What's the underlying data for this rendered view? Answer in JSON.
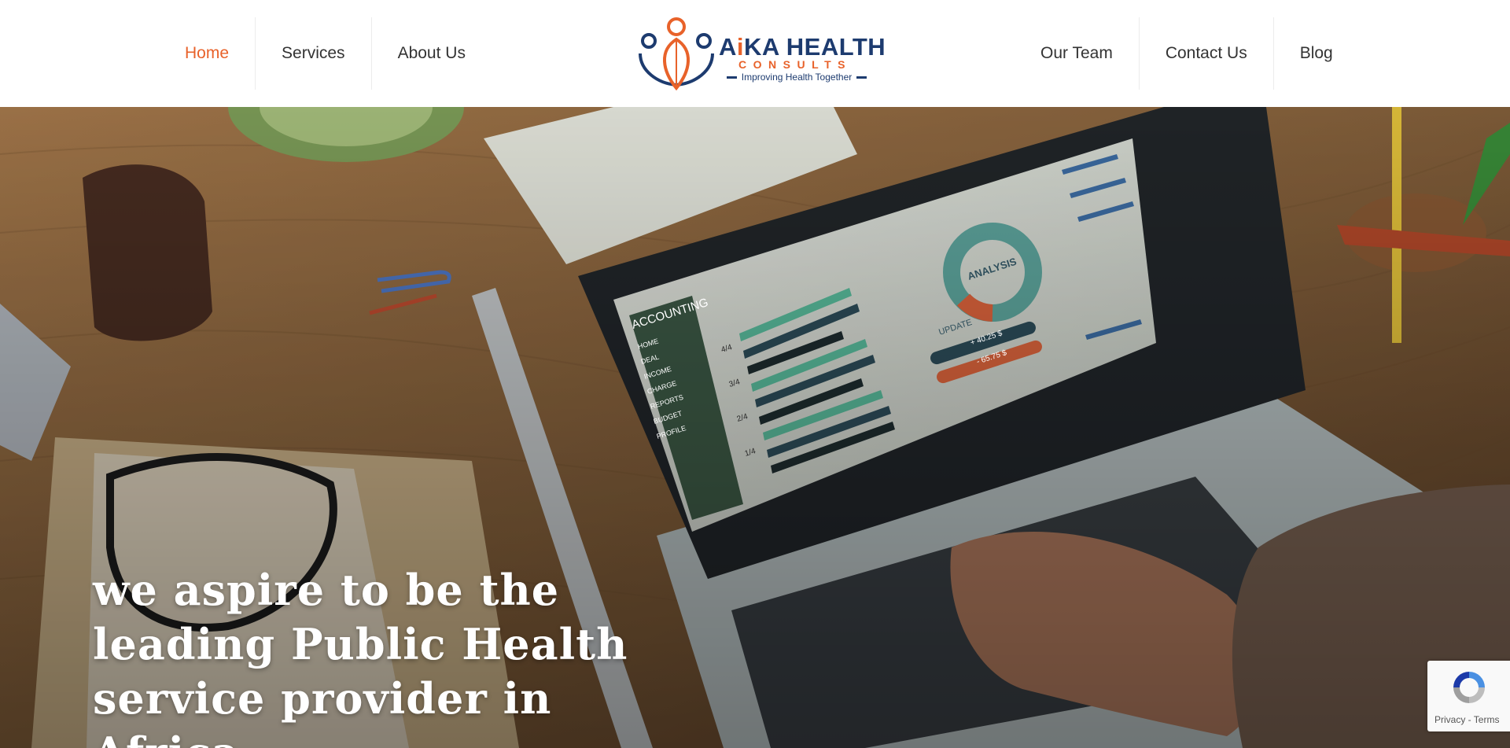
{
  "nav": {
    "left": [
      {
        "label": "Home",
        "active": true
      },
      {
        "label": "Services"
      },
      {
        "label": "About Us"
      }
    ],
    "right": [
      {
        "label": "Our Team"
      },
      {
        "label": "Contact Us"
      },
      {
        "label": "Blog"
      }
    ]
  },
  "logo": {
    "name_prefix": "A",
    "name_i": "i",
    "name_rest": "KA HEALTH",
    "subtitle": "CONSULTS",
    "tagline": "Improving Health Together"
  },
  "hero": {
    "heading": "we aspire to be the leading Public Health service provider in Africa"
  },
  "laptop_screen": {
    "title": "ACCOUNTING",
    "menu": [
      "HOME",
      "DEAL",
      "INCOME",
      "CHARGE",
      "REPORTS",
      "BUDGET",
      "PROFILE"
    ],
    "axis": [
      "4/4",
      "3/4",
      "2/4",
      "1/4"
    ],
    "donut_label": "ANALYSIS",
    "update_label": "UPDATE",
    "update_values": [
      "+ 40.25 $",
      "- 65.75 $"
    ]
  },
  "recaptcha": {
    "privacy": "Privacy",
    "separator": " - ",
    "terms": "Terms"
  },
  "colors": {
    "accent": "#e8622a",
    "brand_navy": "#1d3b6f",
    "nav_text": "#333333"
  }
}
